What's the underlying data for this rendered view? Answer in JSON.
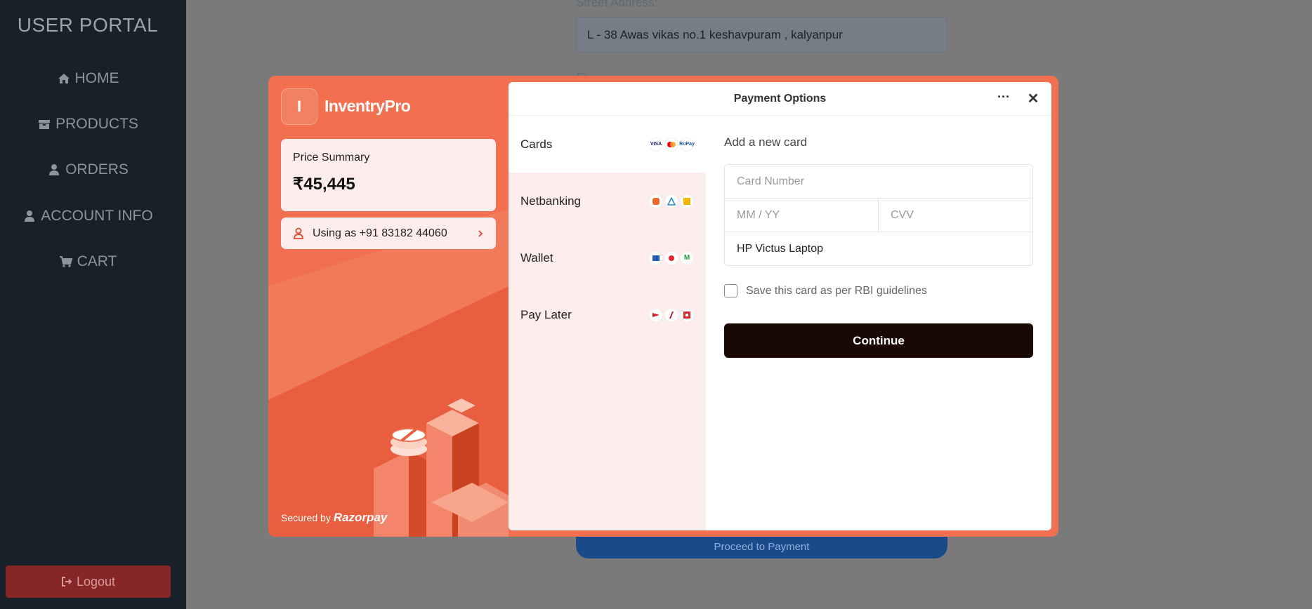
{
  "sidebar": {
    "brand": "USER PORTAL",
    "items": [
      {
        "label": "HOME",
        "icon": "home-icon"
      },
      {
        "label": "PRODUCTS",
        "icon": "box-icon"
      },
      {
        "label": "ORDERS",
        "icon": "user-icon"
      },
      {
        "label": "ACCOUNT INFO",
        "icon": "user-icon"
      },
      {
        "label": "CART",
        "icon": "cart-icon"
      }
    ],
    "logout": "Logout"
  },
  "background_form": {
    "street_label": "Street Address:",
    "street_value": "L - 38 Awas vikas no.1 keshavpuram , kalyanpur",
    "next_label": "Ci",
    "proceed": "Proceed to Payment"
  },
  "checkout": {
    "merchant_initial": "I",
    "merchant_name": "InventryPro",
    "price_label": "Price Summary",
    "price_value": "₹45,445",
    "user_text": "Using as +91 83182 44060",
    "secured_by": "Secured by",
    "provider": "Razorpay",
    "panel_title": "Payment Options",
    "methods": [
      {
        "label": "Cards",
        "icons": [
          "VISA",
          "MC",
          "RuPay"
        ]
      },
      {
        "label": "Netbanking",
        "icons": [
          "bank1",
          "bank2",
          "bank3"
        ]
      },
      {
        "label": "Wallet",
        "icons": [
          "wallet1",
          "wallet2",
          "wallet3"
        ]
      },
      {
        "label": "Pay Later",
        "icons": [
          "pl1",
          "pl2",
          "pl3"
        ]
      }
    ],
    "form": {
      "title": "Add a new card",
      "card_number_placeholder": "Card Number",
      "expiry_placeholder": "MM / YY",
      "cvv_placeholder": "CVV",
      "name_value": "HP Victus Laptop",
      "save_label": "Save this card as per RBI guidelines",
      "continue_label": "Continue"
    }
  },
  "colors": {
    "sidebar_bg": "#182029",
    "overlay": "#7a7a7a",
    "accent": "#f2704f",
    "panel_light": "#fdecec",
    "continue_bg": "#1a0802",
    "logout_bg": "#862626"
  }
}
